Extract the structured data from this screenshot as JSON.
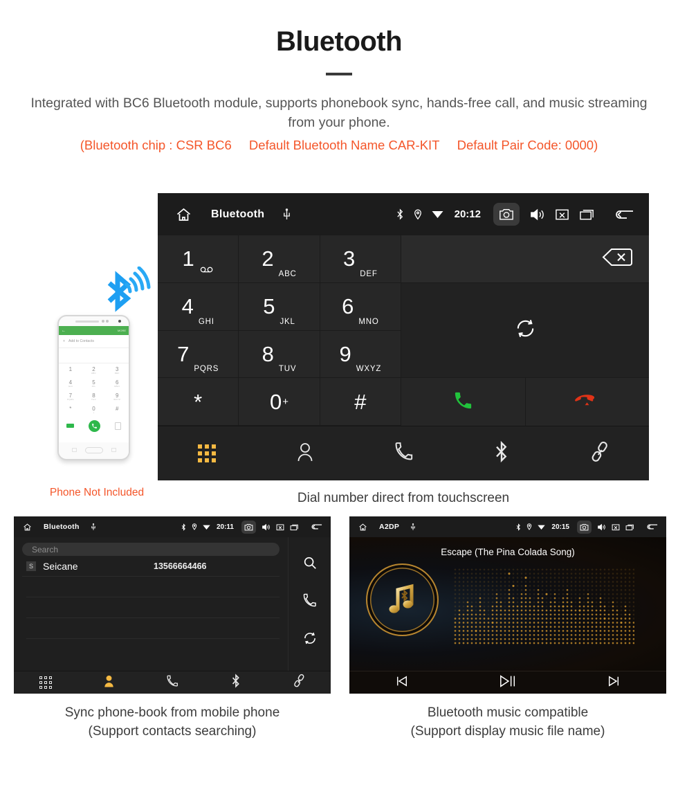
{
  "header": {
    "title": "Bluetooth",
    "description": "Integrated with BC6 Bluetooth module, supports phonebook sync, hands-free call, and music streaming from your phone.",
    "specs": [
      "(Bluetooth chip : CSR BC6",
      "Default Bluetooth Name CAR-KIT",
      "Default Pair Code: 0000)"
    ]
  },
  "colors": {
    "accent_orange": "#f4562a",
    "tab_active": "#f5b942",
    "call_green": "#21c23c",
    "end_red": "#e03317",
    "bluetooth_blue": "#1e9ff2",
    "gold": "#c8912f",
    "screen_bg": "#1f1f1f"
  },
  "main_screen": {
    "statusbar": {
      "home_icon": "home-icon",
      "title": "Bluetooth",
      "usb_icon": "usb-icon",
      "bluetooth_icon": "bluetooth-icon",
      "location_icon": "location-pin-icon",
      "wifi_icon": "wifi-icon",
      "time": "20:12",
      "camera_icon": "camera-icon",
      "volume_icon": "volume-icon",
      "mute_icon": "mute-icon",
      "recents_icon": "recents-icon",
      "back_icon": "back-arrow-icon"
    },
    "keys": [
      {
        "digit": "1",
        "letters": "",
        "sub_icon": "voicemail-icon"
      },
      {
        "digit": "2",
        "letters": "ABC",
        "sub_icon": ""
      },
      {
        "digit": "3",
        "letters": "DEF",
        "sub_icon": ""
      },
      {
        "digit": "4",
        "letters": "GHI",
        "sub_icon": ""
      },
      {
        "digit": "5",
        "letters": "JKL",
        "sub_icon": ""
      },
      {
        "digit": "6",
        "letters": "MNO",
        "sub_icon": ""
      },
      {
        "digit": "7",
        "letters": "PQRS",
        "sub_icon": ""
      },
      {
        "digit": "8",
        "letters": "TUV",
        "sub_icon": ""
      },
      {
        "digit": "9",
        "letters": "WXYZ",
        "sub_icon": ""
      },
      {
        "digit": "*",
        "letters": "",
        "sub_icon": ""
      },
      {
        "digit": "0",
        "letters": "",
        "sub_icon": "plus-sign"
      },
      {
        "digit": "#",
        "letters": "",
        "sub_icon": ""
      }
    ],
    "actions": {
      "backspace_icon": "backspace-icon",
      "sync_icon": "sync-icon",
      "call_icon": "call-handset-icon",
      "end_call_icon": "end-call-icon"
    },
    "tabs": [
      {
        "name": "dialpad",
        "icon": "dialpad-grid-icon",
        "active": true
      },
      {
        "name": "contacts",
        "icon": "person-icon",
        "active": false
      },
      {
        "name": "call-log",
        "icon": "handset-icon",
        "active": false
      },
      {
        "name": "bluetooth",
        "icon": "bluetooth-icon",
        "active": false
      },
      {
        "name": "pair-link",
        "icon": "link-icon",
        "active": false
      }
    ],
    "caption": "Dial number direct from touchscreen"
  },
  "phone_mockup": {
    "note": "Phone Not Included",
    "bluetooth_wave_icon": "bluetooth-signal-icon",
    "screen": {
      "back_icon": "back-arrow-icon",
      "more_label": "MORE",
      "add_label": "Add to Contacts",
      "plus_icon": "plus-icon",
      "keys": [
        {
          "digit": "1",
          "letters": ""
        },
        {
          "digit": "2",
          "letters": "ABC"
        },
        {
          "digit": "3",
          "letters": "DEF"
        },
        {
          "digit": "4",
          "letters": "GHI"
        },
        {
          "digit": "5",
          "letters": "JKL"
        },
        {
          "digit": "6",
          "letters": "MNO"
        },
        {
          "digit": "7",
          "letters": "PQRS"
        },
        {
          "digit": "8",
          "letters": "TUV"
        },
        {
          "digit": "9",
          "letters": "WXYZ"
        },
        {
          "digit": "*",
          "letters": ""
        },
        {
          "digit": "0",
          "letters": "+"
        },
        {
          "digit": "#",
          "letters": ""
        }
      ],
      "call_icon": "call-handset-icon",
      "backspace_icon": "backspace-icon",
      "keypad_toggle_icon": "keypad-icon"
    }
  },
  "phonebook_panel": {
    "statusbar": {
      "title": "Bluetooth",
      "time": "20:11"
    },
    "search_placeholder": "Search",
    "contacts": [
      {
        "initial": "S",
        "name": "Seicane",
        "number": "13566664466"
      }
    ],
    "side_actions": [
      {
        "name": "search",
        "icon": "search-icon"
      },
      {
        "name": "call",
        "icon": "handset-icon"
      },
      {
        "name": "sync",
        "icon": "sync-icon"
      }
    ],
    "tabs": [
      {
        "name": "dialpad",
        "icon": "dialpad-grid-icon",
        "active": false
      },
      {
        "name": "contacts",
        "icon": "person-icon",
        "active": true
      },
      {
        "name": "call-log",
        "icon": "handset-icon",
        "active": false
      },
      {
        "name": "bluetooth",
        "icon": "bluetooth-icon",
        "active": false
      },
      {
        "name": "pair-link",
        "icon": "link-icon",
        "active": false
      }
    ],
    "caption_line1": "Sync phone-book from mobile phone",
    "caption_line2": "(Support contacts searching)"
  },
  "music_panel": {
    "statusbar": {
      "title": "A2DP",
      "time": "20:15"
    },
    "track_title": "Escape (The Pina Colada Song)",
    "album_icon": "music-note-bluetooth-icon",
    "visualizer": "dot-matrix-equalizer",
    "controls": [
      {
        "name": "previous",
        "icon": "previous-track-icon"
      },
      {
        "name": "play-pause",
        "icon": "play-pause-icon"
      },
      {
        "name": "next",
        "icon": "next-track-icon"
      }
    ],
    "caption_line1": "Bluetooth music compatible",
    "caption_line2": "(Support display music file name)"
  }
}
